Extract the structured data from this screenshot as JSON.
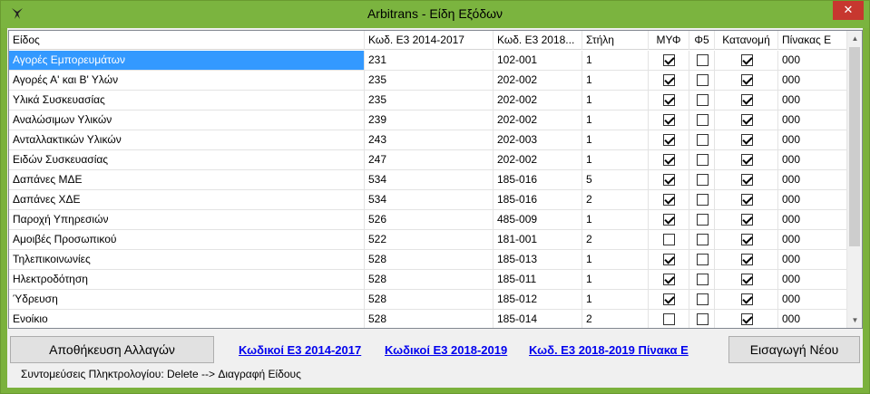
{
  "window": {
    "title": "Arbitrans - Είδη Εξόδων",
    "close_glyph": "✕"
  },
  "table": {
    "columns": [
      "Είδος",
      "Κωδ. Ε3 2014-2017",
      "Κωδ. Ε3 2018...",
      "Στήλη",
      "ΜΥΦ",
      "Φ5",
      "Κατανομή",
      "Πίνακας Ε"
    ],
    "rows": [
      {
        "name": "Αγορές Εμπορευμάτων",
        "e3_2014": "231",
        "e3_2018": "102-001",
        "col": "1",
        "myf": true,
        "f5": false,
        "katanomi": true,
        "pinakas": "000"
      },
      {
        "name": "Αγορές Α' και Β' Υλών",
        "e3_2014": "235",
        "e3_2018": "202-002",
        "col": "1",
        "myf": true,
        "f5": false,
        "katanomi": true,
        "pinakas": "000"
      },
      {
        "name": "Υλικά Συσκευασίας",
        "e3_2014": "235",
        "e3_2018": "202-002",
        "col": "1",
        "myf": true,
        "f5": false,
        "katanomi": true,
        "pinakas": "000"
      },
      {
        "name": "Αναλώσιμων Υλικών",
        "e3_2014": "239",
        "e3_2018": "202-002",
        "col": "1",
        "myf": true,
        "f5": false,
        "katanomi": true,
        "pinakas": "000"
      },
      {
        "name": "Ανταλλακτικών Υλικών",
        "e3_2014": "243",
        "e3_2018": "202-003",
        "col": "1",
        "myf": true,
        "f5": false,
        "katanomi": true,
        "pinakas": "000"
      },
      {
        "name": "Ειδών Συσκευασίας",
        "e3_2014": "247",
        "e3_2018": "202-002",
        "col": "1",
        "myf": true,
        "f5": false,
        "katanomi": true,
        "pinakas": "000"
      },
      {
        "name": "Δαπάνες ΜΔΕ",
        "e3_2014": "534",
        "e3_2018": "185-016",
        "col": "5",
        "myf": true,
        "f5": false,
        "katanomi": true,
        "pinakas": "000"
      },
      {
        "name": "Δαπάνες ΧΔΕ",
        "e3_2014": "534",
        "e3_2018": "185-016",
        "col": "2",
        "myf": true,
        "f5": false,
        "katanomi": true,
        "pinakas": "000"
      },
      {
        "name": "Παροχή Υπηρεσιών",
        "e3_2014": "526",
        "e3_2018": "485-009",
        "col": "1",
        "myf": true,
        "f5": false,
        "katanomi": true,
        "pinakas": "000"
      },
      {
        "name": "Αμοιβές Προσωπικού",
        "e3_2014": "522",
        "e3_2018": "181-001",
        "col": "2",
        "myf": false,
        "f5": false,
        "katanomi": true,
        "pinakas": "000"
      },
      {
        "name": "Τηλεπικοινωνίες",
        "e3_2014": "528",
        "e3_2018": "185-013",
        "col": "1",
        "myf": true,
        "f5": false,
        "katanomi": true,
        "pinakas": "000"
      },
      {
        "name": "Ηλεκτροδότηση",
        "e3_2014": "528",
        "e3_2018": "185-011",
        "col": "1",
        "myf": true,
        "f5": false,
        "katanomi": true,
        "pinakas": "000"
      },
      {
        "name": "Ύδρευση",
        "e3_2014": "528",
        "e3_2018": "185-012",
        "col": "1",
        "myf": true,
        "f5": false,
        "katanomi": true,
        "pinakas": "000"
      },
      {
        "name": "Ενοίκιο",
        "e3_2014": "528",
        "e3_2018": "185-014",
        "col": "2",
        "myf": false,
        "f5": false,
        "katanomi": true,
        "pinakas": "000"
      }
    ]
  },
  "footer": {
    "save_label": "Αποθήκευση Αλλαγών",
    "link_2014": "Κωδικοί Ε3 2014-2017",
    "link_2018": "Κωδικοί Ε3 2018-2019",
    "link_pinakas": "Κωδ. Ε3 2018-2019 Πίνακα Ε",
    "new_label": "Εισαγωγή Νέου",
    "shortcuts": "Συντομεύσεις Πληκτρολογίου: Delete --> Διαγραφή Είδους"
  },
  "colors": {
    "titlebar": "#7bb43f",
    "selection": "#3399ff",
    "close": "#c7372f",
    "link": "#0000ee"
  }
}
